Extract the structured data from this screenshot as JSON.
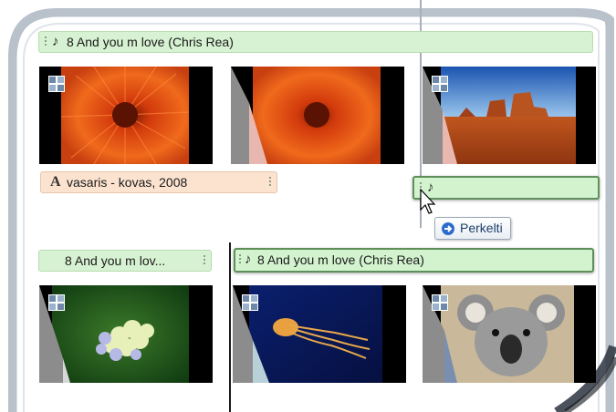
{
  "storyboard": {
    "row1": {
      "caption": "8 And you m love (Chris Rea)",
      "clips": [
        {
          "image": "red-chrysanthemum"
        },
        {
          "image": "red-chrysanthemum-transition"
        },
        {
          "image": "desert-mesa"
        }
      ],
      "title_caption": "vasaris - kovas, 2008"
    },
    "drag": {
      "music_caption": "",
      "tooltip": "Perkelti"
    },
    "row2": {
      "caption_left": "8 And you m lov...",
      "caption_right": "8 And you m love (Chris Rea)",
      "clips": [
        {
          "image": "hydrangea-flowers"
        },
        {
          "image": "jellyfish"
        },
        {
          "image": "koala"
        }
      ]
    }
  },
  "icons": {
    "music": "music-note-icon",
    "title": "text-a-icon",
    "transition": "transition-icon",
    "move": "arrow-right-icon",
    "cursor": "mouse-pointer-icon"
  },
  "colors": {
    "music_caption_bg": "#d7f2d2",
    "title_caption_bg": "#fbe3d0",
    "tooltip_text": "#1c3d6a"
  }
}
